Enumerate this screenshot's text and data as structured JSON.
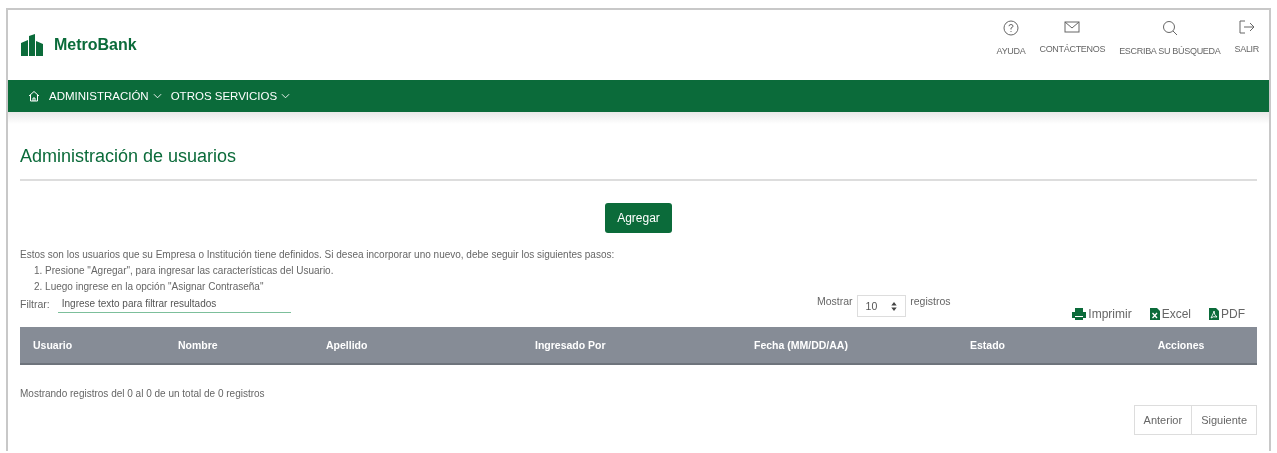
{
  "brand": {
    "name": "MetroBank"
  },
  "top_links": [
    {
      "label": "AYUDA",
      "kind": "help"
    },
    {
      "label": "CONTÁCTENOS",
      "kind": "mail"
    },
    {
      "label": "ESCRIBA SU BÚSQUEDA",
      "kind": "search"
    },
    {
      "label": "SALIR",
      "kind": "logout"
    }
  ],
  "nav": [
    {
      "label": "ADMINISTRACIÓN"
    },
    {
      "label": "OTROS SERVICIOS"
    }
  ],
  "page_title": "Administración de usuarios",
  "add_button": "Agregar",
  "intro": "Estos son los usuarios que su Empresa o Institución tiene definidos. Si desea incorporar uno nuevo, debe seguir los siguientes pasos:",
  "steps": [
    "1. Presione \"Agregar\", para ingresar las características del Usuario.",
    "2. Luego ingrese en la opción \"Asignar Contraseña\""
  ],
  "filter": {
    "label": "Filtrar:",
    "placeholder": "Ingrese texto para filtrar resultados"
  },
  "page_size": {
    "label": "Mostrar",
    "value": "10",
    "suffix": "registros"
  },
  "exports": [
    {
      "label": "Imprimir",
      "kind": "print"
    },
    {
      "label": "Excel",
      "kind": "excel"
    },
    {
      "label": "PDF",
      "kind": "pdf"
    }
  ],
  "table": {
    "columns": [
      "Usuario",
      "Nombre",
      "Apellido",
      "Ingresado Por",
      "Fecha (MM/DD/AA)",
      "Estado",
      "Acciones"
    ]
  },
  "summary": "Mostrando registros del 0 al 0 de un total de 0 registros",
  "pagination": [
    "Anterior",
    "Siguiente"
  ]
}
